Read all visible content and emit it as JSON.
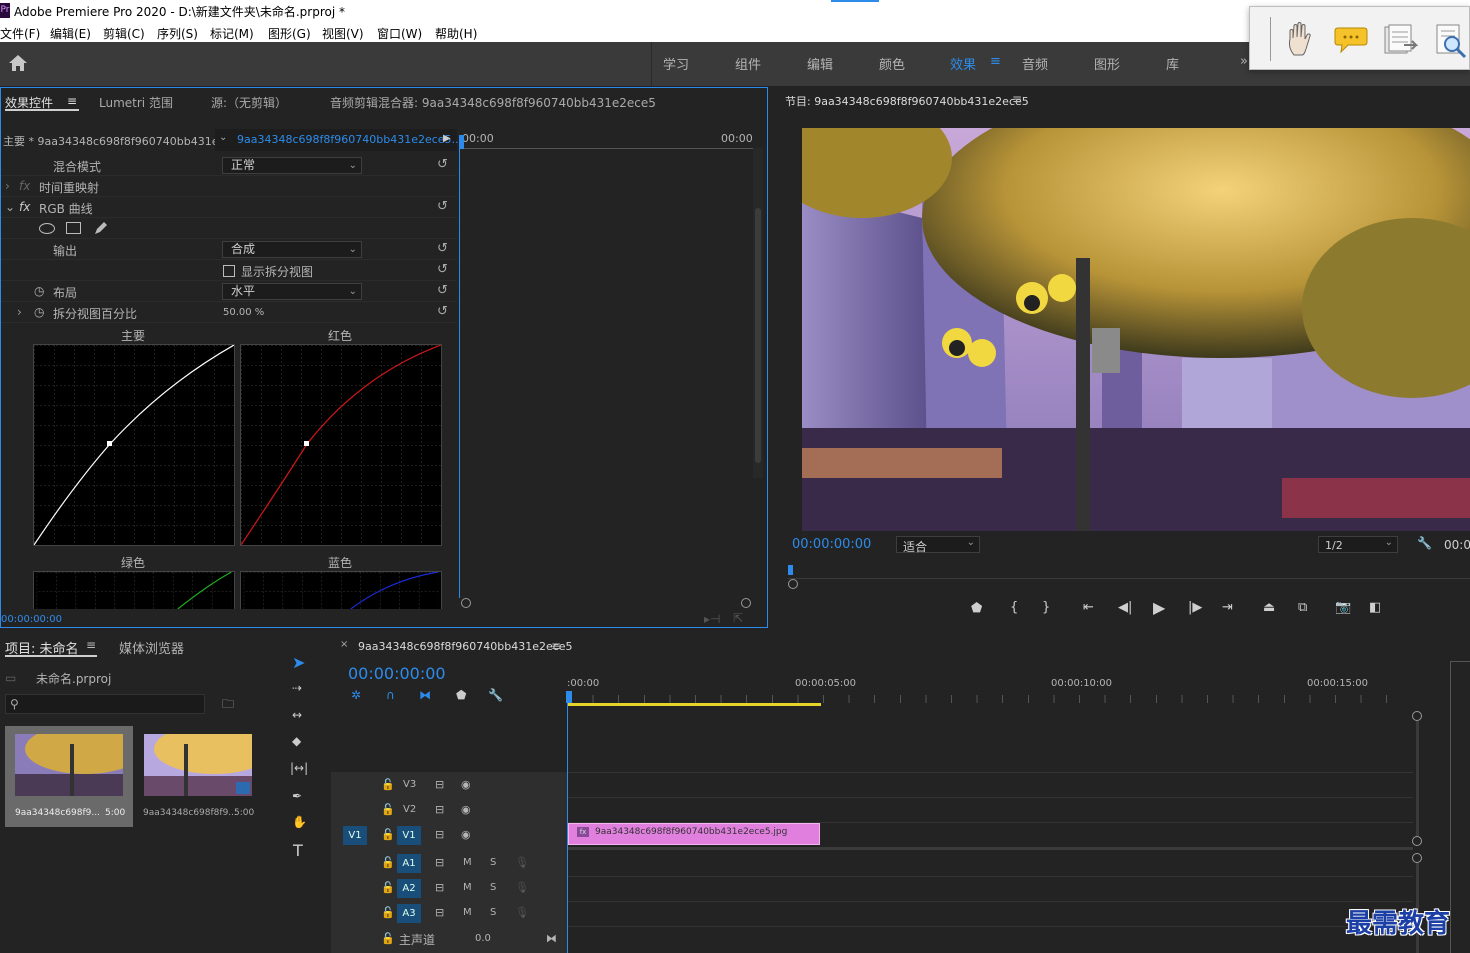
{
  "titlebar": {
    "title": "Adobe Premiere Pro 2020 - D:\\新建文件夹\\未命名.prproj *",
    "logo": "Pr"
  },
  "menu": [
    "文件(F)",
    "编辑(E)",
    "剪辑(C)",
    "序列(S)",
    "标记(M)",
    "图形(G)",
    "视图(V)",
    "窗口(W)",
    "帮助(H)"
  ],
  "workspaces": [
    {
      "label": "学习",
      "active": false
    },
    {
      "label": "组件",
      "active": false
    },
    {
      "label": "编辑",
      "active": false
    },
    {
      "label": "颜色",
      "active": false
    },
    {
      "label": "效果",
      "active": true
    },
    {
      "label": "音频",
      "active": false
    },
    {
      "label": "图形",
      "active": false
    },
    {
      "label": "库",
      "active": false
    }
  ],
  "effects": {
    "tabs": [
      "效果控件",
      "Lumetri 范围",
      "源:（无剪辑）",
      "音频剪辑混合器: 9aa34348c698f8f960740bb431e2ece5"
    ],
    "master_label": "主要 * 9aa34348c698f8f960740bb431e...",
    "clip_label": "9aa34348c698f8f960740bb431e2ece5...",
    "tc_start": "00:00",
    "tc_end": "00:00",
    "blend_label": "混合模式",
    "blend_value": "正常",
    "time_remap": "时间重映射",
    "rgb_curves": "RGB 曲线",
    "output_label": "输出",
    "output_value": "合成",
    "split_view": "显示拆分视图",
    "layout_label": "布局",
    "layout_value": "水平",
    "split_pct_label": "拆分视图百分比",
    "split_pct_value": "50.00 %",
    "graph_master": "主要",
    "graph_red": "红色",
    "graph_green": "绿色",
    "graph_blue": "蓝色",
    "bottom_tc": "00:00:00:00",
    "fx": "fx"
  },
  "program": {
    "title": "节目: 9aa34348c698f8f960740bb431e2ece5",
    "timecode": "00:00:00:00",
    "fit": "适合",
    "resolution": "1/2",
    "tc_right": "00:0"
  },
  "project": {
    "tab1": "项目: 未命名",
    "tab2": "媒体浏览器",
    "file": "未命名.prproj",
    "items": [
      {
        "name": "9aa34348c698f9...",
        "dur": "5:00"
      },
      {
        "name": "9aa34348c698f8f9...",
        "dur": "5:00"
      }
    ]
  },
  "timeline": {
    "seq_name": "9aa34348c698f8f960740bb431e2ece5",
    "timecode": "00:00:00:00",
    "ruler": [
      ":00:00",
      "00:00:05:00",
      "00:00:10:00",
      "00:00:15:00"
    ],
    "video_tracks": [
      "V3",
      "V2",
      "V1"
    ],
    "audio_tracks": [
      "A1",
      "A2",
      "A3"
    ],
    "source_patch": "V1",
    "master": "主声道",
    "master_vol": "0.0",
    "clip_name": "9aa34348c698f8f960740bb431e2ece5.jpg",
    "m": "M",
    "s": "S"
  },
  "watermark": "最需教育"
}
